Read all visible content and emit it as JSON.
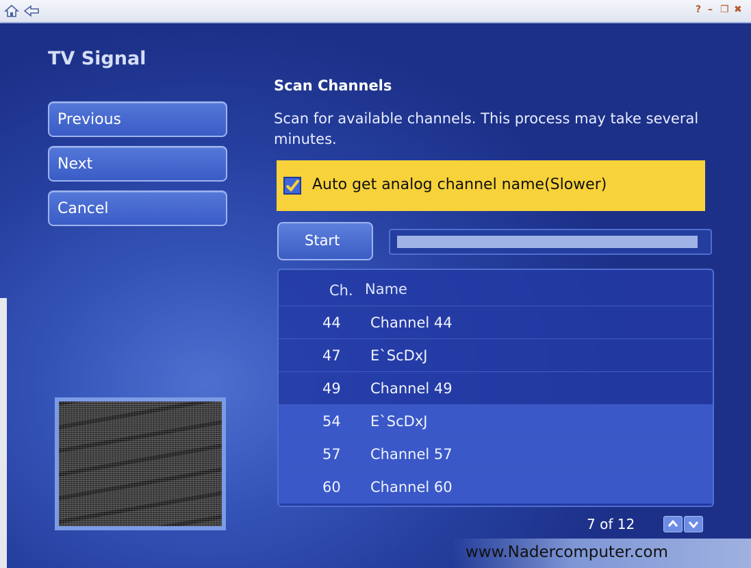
{
  "window": {
    "help_symbol": "?",
    "minimize_symbol": "–",
    "restore_symbol": "❐",
    "close_symbol": "✖"
  },
  "page": {
    "title": "TV Signal"
  },
  "nav": {
    "previous_label": "Previous",
    "next_label": "Next",
    "cancel_label": "Cancel"
  },
  "scan": {
    "title": "Scan Channels",
    "description": "Scan for available channels. This process may take several minutes.",
    "auto_name_label": "Auto get analog channel name(Slower)",
    "auto_name_checked": true,
    "start_label": "Start",
    "progress_fraction": 0.98
  },
  "list": {
    "header_ch": "Ch.",
    "header_name": "Name",
    "rows": [
      {
        "ch": "44",
        "name": "Channel 44"
      },
      {
        "ch": "47",
        "name": "E`ScDxJ"
      },
      {
        "ch": "49",
        "name": "Channel 49"
      },
      {
        "ch": "54",
        "name": "E`ScDxJ"
      },
      {
        "ch": "57",
        "name": "Channel 57"
      },
      {
        "ch": "60",
        "name": "Channel 60"
      }
    ]
  },
  "pager": {
    "text": "7 of 12"
  },
  "footer": {
    "watermark": "www.Nadercomputer.com"
  },
  "colors": {
    "background": "#2a3f9a",
    "checkbar": "#f7d23a",
    "button": "#4a6dd4"
  }
}
